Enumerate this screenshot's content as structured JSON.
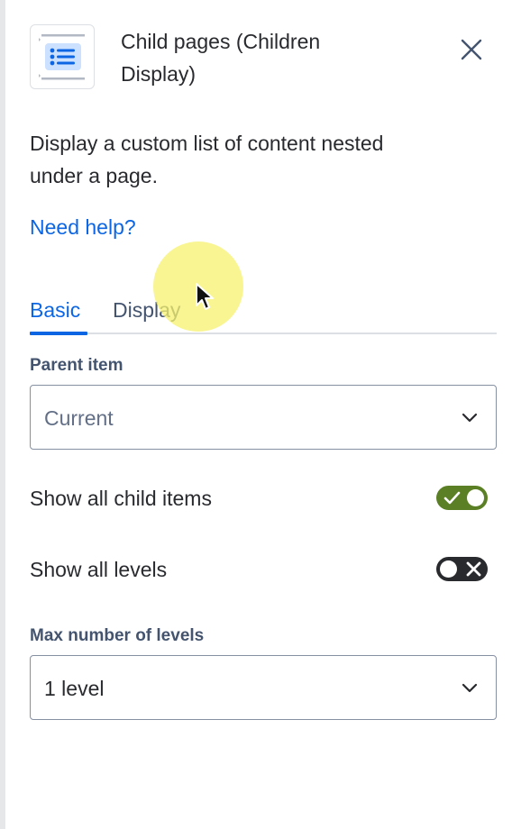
{
  "header": {
    "title_line1": "Child pages (Children",
    "title_line2": "Display)",
    "macro_icon": "list-icon",
    "close_icon": "close-icon"
  },
  "description": {
    "line1": "Display a custom list of content nested",
    "line2": "under a page."
  },
  "help_link": "Need help?",
  "tabs": [
    {
      "label": "Basic",
      "selected": true
    },
    {
      "label": "Display",
      "selected": false
    }
  ],
  "parent_item": {
    "label": "Parent item",
    "value": "Current"
  },
  "show_all_child_items": {
    "label": "Show all child items",
    "checked": true
  },
  "show_all_levels": {
    "label": "Show all levels",
    "checked": false
  },
  "max_levels": {
    "label": "Max number of levels",
    "value": "1 level"
  },
  "colors": {
    "accent": "#0c66e4",
    "toggle_on": "#5b7f24",
    "toggle_off": "#292a2e",
    "cursor_highlight": "#f6f26e"
  }
}
